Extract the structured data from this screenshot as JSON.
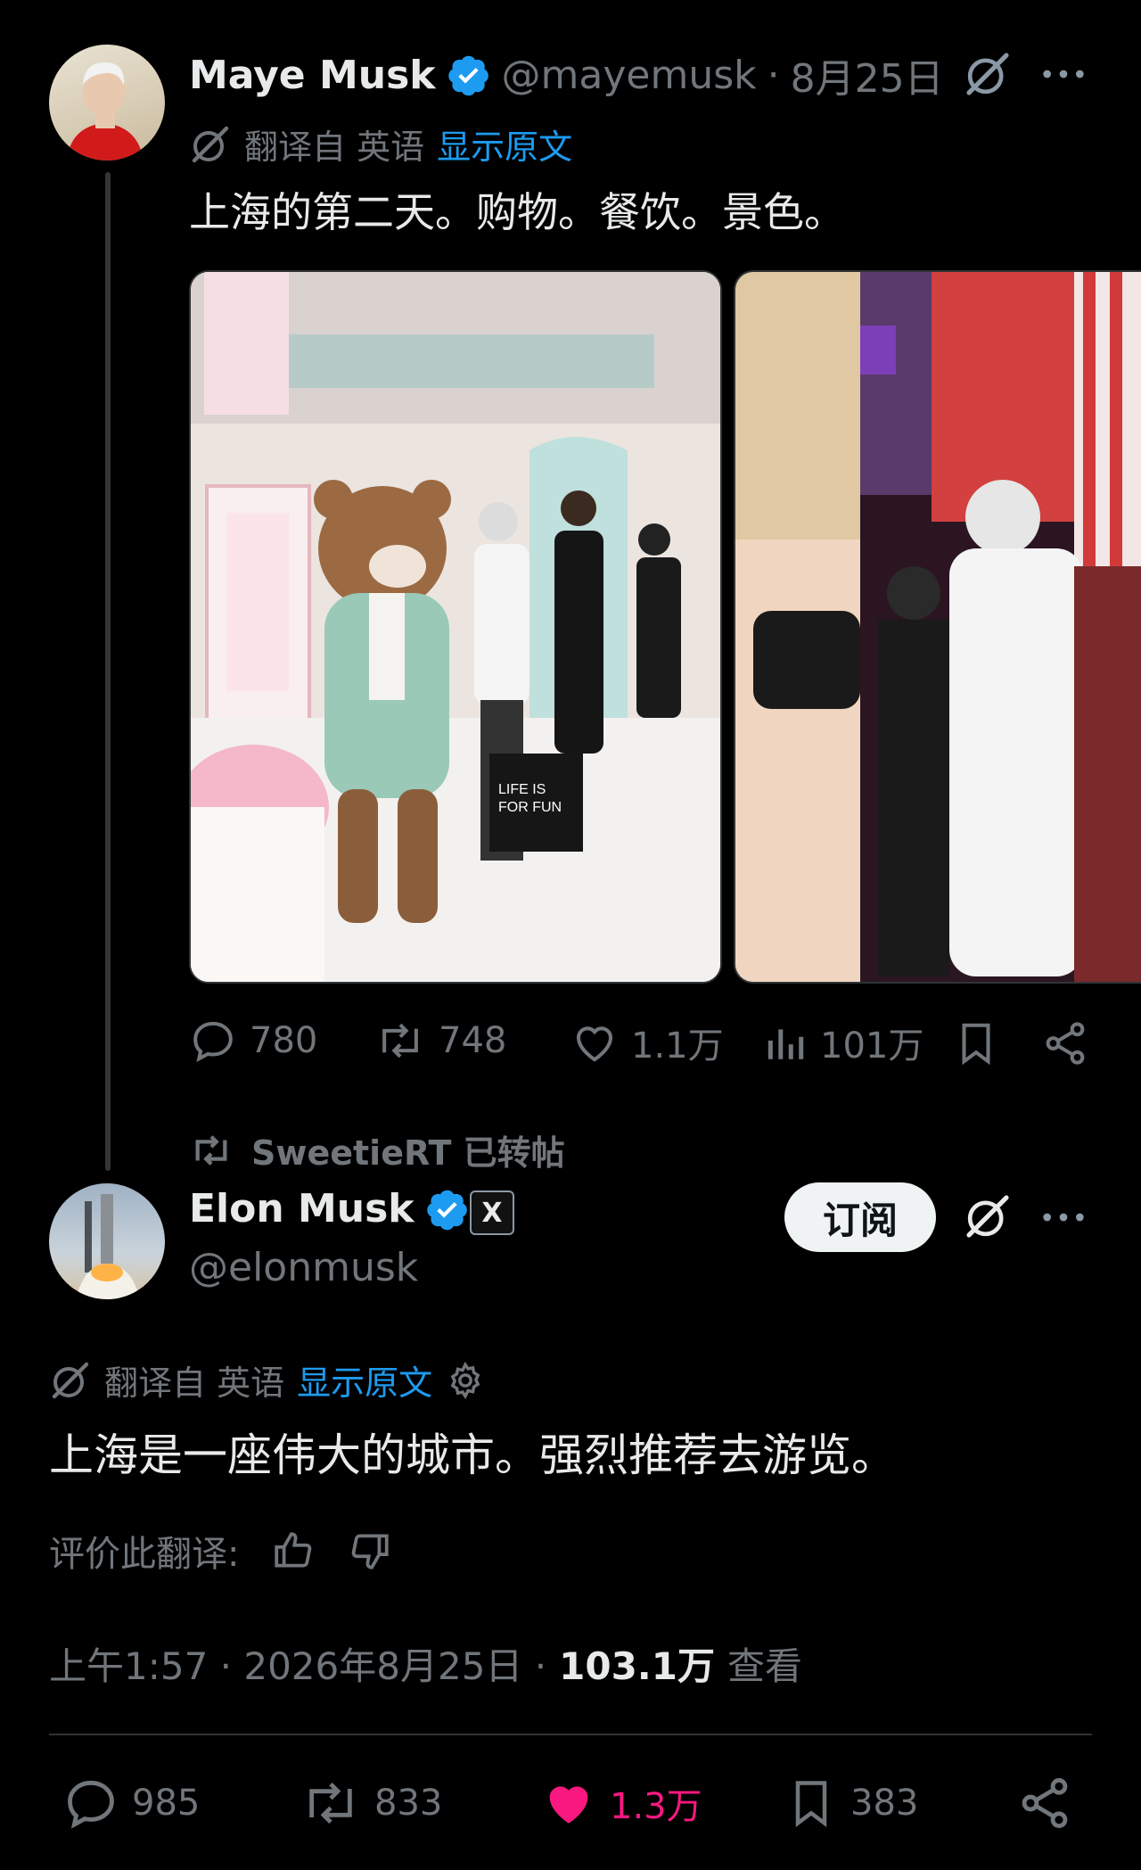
{
  "tweet1": {
    "name": "Maye Musk",
    "handle": "@mayemusk",
    "separator": "·",
    "date": "8月25日",
    "translated_from": "翻译自 英语",
    "show_original": "显示原文",
    "text": "上海的第二天。购物。餐饮。景色。",
    "photo1_bag_text": "LIFE IS FOR FUN",
    "stats": {
      "replies": "780",
      "retweets": "748",
      "likes": "1.1万",
      "views": "101万"
    }
  },
  "repost_bar": {
    "text": "SweetieRT 已转帖"
  },
  "tweet2": {
    "name": "Elon Musk",
    "handle": "@elonmusk",
    "badge": "X",
    "subscribe_label": "订阅",
    "translated_from": "翻译自 英语",
    "show_original": "显示原文",
    "text": "上海是一座伟大的城市。强烈推荐去游览。",
    "rate_translation": "评价此翻译:",
    "timestamp": "上午1:57 · 2026年8月25日 ·",
    "view_count": "103.1万",
    "views_label": "查看",
    "stats": {
      "replies": "985",
      "retweets": "833",
      "likes": "1.3万",
      "bookmarks": "383"
    }
  },
  "colors": {
    "background": "#000000",
    "text": "#e7e9ea",
    "muted": "#71767b",
    "link": "#1d9bf0",
    "verified": "#1d9bf0",
    "like_active": "#f91880"
  },
  "icons": [
    "verified-badge-icon",
    "grok-icon",
    "more-icon",
    "reply-icon",
    "retweet-icon",
    "like-icon",
    "views-icon",
    "bookmark-icon",
    "share-icon",
    "settings-icon",
    "thumbs-up-icon",
    "thumbs-down-icon"
  ]
}
